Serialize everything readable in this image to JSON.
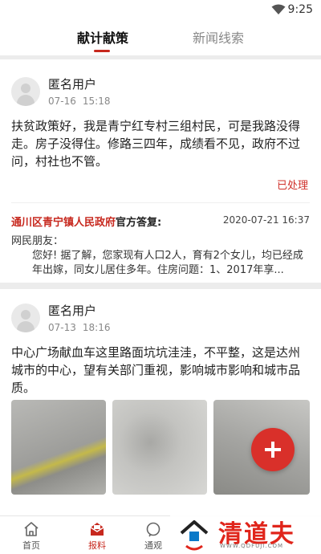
{
  "status_bar": {
    "time": "9:25"
  },
  "tabs": [
    {
      "label": "献计献策",
      "active": true
    },
    {
      "label": "新闻线索",
      "active": false
    }
  ],
  "posts": [
    {
      "user": "匿名用户",
      "date": "07-16",
      "time": "15:18",
      "content": "扶贫政策好，我是青宁红专村三组村民，可是我路没得走。房子没得住。修路三四年，成绩看不见，政府不过问，村社也不管。",
      "status": "已处理",
      "reply": {
        "org": "通川区青宁镇人民政府",
        "suffix": "官方答复:",
        "date": "2020-07-21 16:37",
        "greeting": "网民朋友：",
        "body": "您好! 据了解，您家现有人口2人，育有2个女儿，均已经成年出嫁，同女儿居住多年。住房问题：1、2017年享..."
      }
    },
    {
      "user": "匿名用户",
      "date": "07-13",
      "time": "18:16",
      "content": "中心广场献血车这里路面坑坑洼洼，不平整，这是达州城市的中心，望有关部门重视，影响城市影响和城市品质。"
    }
  ],
  "bottom_nav": [
    {
      "label": "首页",
      "icon": "home-icon",
      "active": false
    },
    {
      "label": "报料",
      "icon": "envelope-icon",
      "active": true
    },
    {
      "label": "通观",
      "icon": "chat-icon",
      "active": false
    }
  ],
  "watermark": {
    "title": "清道夫",
    "url": "WWW.QDFUJI.COM"
  },
  "colors": {
    "accent": "#c7281e",
    "fab": "#d9302a"
  }
}
